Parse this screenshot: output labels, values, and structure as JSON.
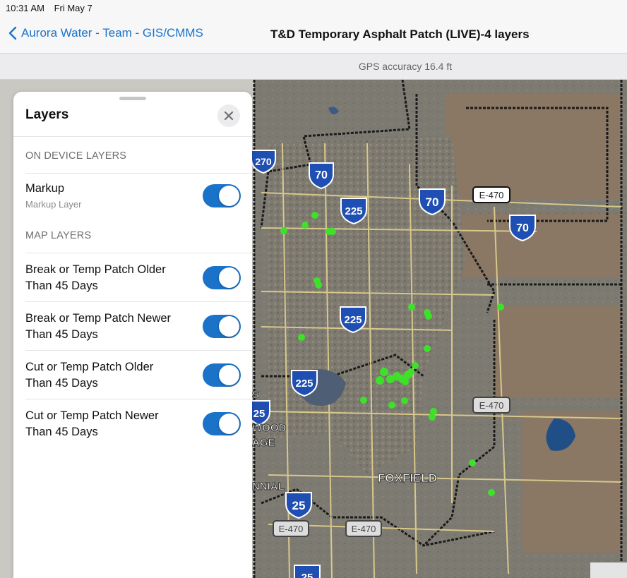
{
  "status_bar": {
    "time": "10:31 AM",
    "date": "Fri May 7"
  },
  "nav": {
    "back_label": "Aurora Water - Team - GIS/CMMS",
    "title": "T&D Temporary Asphalt Patch (LIVE)-4 layers"
  },
  "gps": {
    "text": "GPS accuracy 16.4 ft"
  },
  "colors": {
    "accent": "#1a73c9",
    "point": "#3ee02a"
  },
  "map": {
    "labels": {
      "foxfield": "FOXFIELD",
      "wood": "WOOD",
      "age": "AGE",
      "nnial": "NNIAL",
      "s": "S"
    },
    "shields": {
      "i270": "270",
      "i70_a": "70",
      "i70_b": "70",
      "i70_c": "70",
      "i225_a": "225",
      "i225_b": "225",
      "i225_c": "225",
      "i25_a": "25",
      "i25_b": "25",
      "i25_c": "25",
      "e470_a": "E-470",
      "e470_b": "E-470",
      "e470_c": "E-470",
      "e470_d": "E-470"
    }
  },
  "panel": {
    "title": "Layers",
    "sections": {
      "on_device": "ON DEVICE LAYERS",
      "map_layers": "MAP LAYERS"
    },
    "markup": {
      "name": "Markup",
      "sub": "Markup Layer",
      "enabled": true
    },
    "layers": [
      {
        "line1": "Break or Temp Patch Older",
        "line2": "Than 45 Days",
        "enabled": true
      },
      {
        "line1": "Break or Temp Patch Newer",
        "line2": "Than 45 Days",
        "enabled": true
      },
      {
        "line1": "Cut or Temp Patch Older",
        "line2": "Than 45 Days",
        "enabled": true
      },
      {
        "line1": "Cut or Temp Patch Newer",
        "line2": "Than 45 Days",
        "enabled": true
      }
    ]
  }
}
